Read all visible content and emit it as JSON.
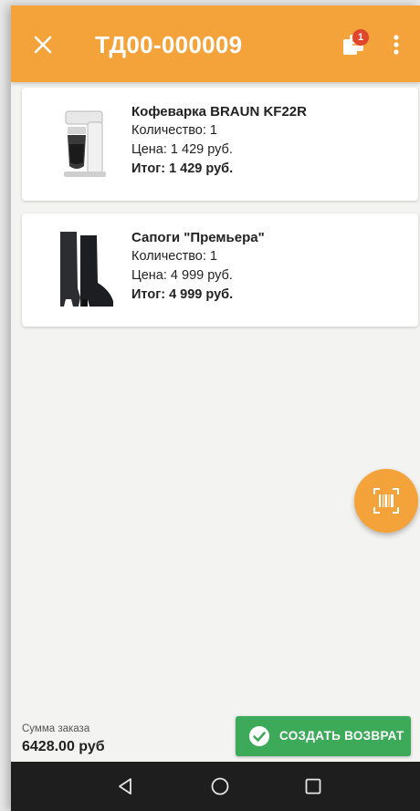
{
  "header": {
    "title": "ТД00-000009",
    "badge": "1",
    "colors": {
      "accent": "#f4a23a",
      "badge": "#e0462b"
    }
  },
  "items": [
    {
      "name": "Кофеварка BRAUN KF22R",
      "quantity": "Количество: 1",
      "price": "Цена: 1 429 руб.",
      "total": "Итог: 1 429 руб.",
      "icon": "coffee-maker-image"
    },
    {
      "name": "Сапоги \"Премьера\"",
      "quantity": "Количество: 1",
      "price": "Цена: 4 999 руб.",
      "total": "Итог: 4 999 руб.",
      "icon": "boots-image"
    }
  ],
  "footer": {
    "sum_label": "Сумма заказа",
    "sum_value": "6428.00 руб",
    "return_label": "СОЗДАТЬ ВОЗВРАТ",
    "return_color": "#3daa5a"
  },
  "icons": {
    "close": "close-icon",
    "report": "report-icon",
    "more": "more-vert-icon",
    "scan": "barcode-scan-icon",
    "check": "check-circle-icon",
    "nav": [
      "back-icon",
      "home-icon",
      "recents-icon"
    ]
  }
}
